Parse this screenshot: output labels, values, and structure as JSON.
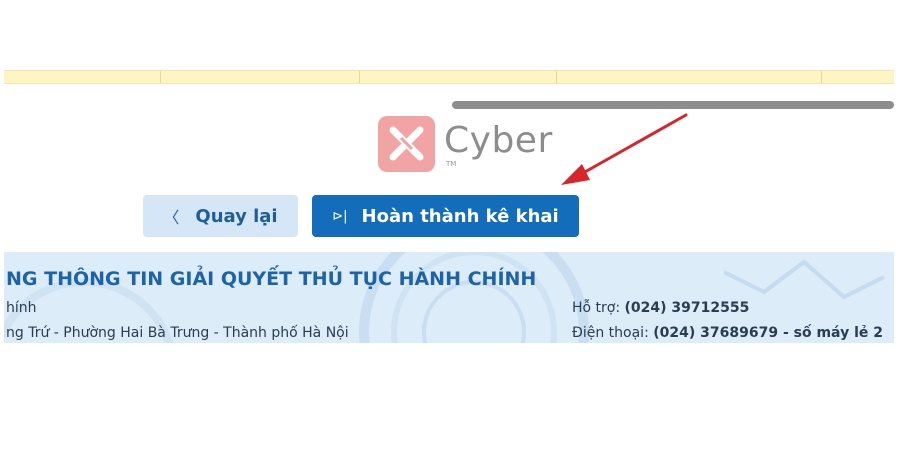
{
  "logo": {
    "text": "Cyber",
    "tm": "TM",
    "badge_color": "#f2a3a3"
  },
  "buttons": {
    "back": {
      "icon": "chevron-left-icon",
      "glyph": "〈",
      "label": "Quay lại"
    },
    "finish": {
      "icon": "skip-forward-icon",
      "glyph": "⊳|",
      "label": "Hoàn thành kê khai"
    }
  },
  "footer": {
    "title": "NG THÔNG TIN GIẢI QUYẾT THỦ TỤC HÀNH CHÍNH",
    "left_line1": "hính",
    "left_line2": "ng Trứ - Phường Hai Bà Trưng - Thành phố Hà Nội",
    "support_label": "Hỗ trợ:",
    "support_value": "(024) 39712555",
    "phone_label": "Điện thoại:",
    "phone_value": "(024) 37689679 - số máy lẻ 2"
  },
  "colors": {
    "primary": "#136dba",
    "secondary_bg": "#d5e7f7",
    "arrow": "#d9252a",
    "title": "#1d63a8"
  }
}
